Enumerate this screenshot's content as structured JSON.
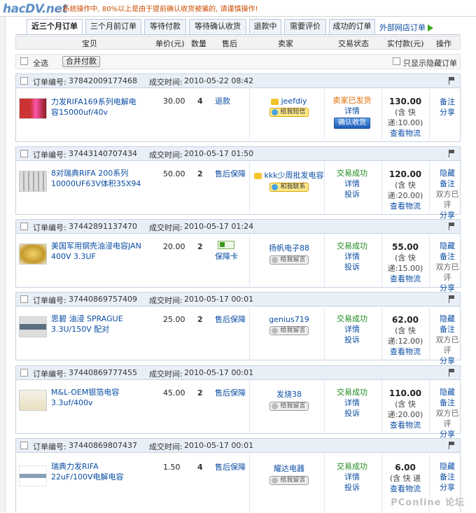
{
  "site": {
    "logo": "hacDV.net",
    "notice": "...系统操作中, 80%以上是由于提前确认收货被骗的, 请谨慎操作!"
  },
  "tabs": [
    {
      "label": "近三个月订单",
      "active": true
    },
    {
      "label": "三个月前订单",
      "active": false
    },
    {
      "label": "等待付款",
      "active": false
    },
    {
      "label": "等待确认收货",
      "active": false
    },
    {
      "label": "退款中",
      "active": false
    },
    {
      "label": "需要评价",
      "active": false
    },
    {
      "label": "成功的订单",
      "active": false
    }
  ],
  "external_link": "外部网店订单",
  "columns": {
    "item": "宝贝",
    "price": "单价(元)",
    "qty": "数量",
    "after_sale": "售后",
    "seller": "卖家",
    "status": "交易状态",
    "paid": "实付款(元)",
    "ops": "操作"
  },
  "toolbar": {
    "select_all": "全选",
    "merge_pay": "合并付款",
    "only_hidden": "只显示隐藏订单"
  },
  "orders": [
    {
      "order_label": "订单编号:",
      "order_no": "37842009177468",
      "time_label": "成交时间:",
      "time": "2010-05-22 08:42",
      "title": "力发RIFA169系列电解电容15000uf/40v",
      "price": "30.00",
      "qty": "4",
      "after_sale": "退款",
      "seller": "jeefdiy",
      "seller_button": "给我短信",
      "status_main": "卖家已发货",
      "status_detail": "详情",
      "status_extra": "",
      "confirm_button": "确认收货",
      "paid": "130.00",
      "paid_note": "(含 快 递:10.00)",
      "logistics": "查看物流",
      "ops": [
        "备注",
        "分享"
      ]
    },
    {
      "order_label": "订单编号:",
      "order_no": "37443140707434",
      "time_label": "成交时间:",
      "time": "2010-05-17 01:50",
      "title": "8对瑞典RIFA 200系列 10000UF63V体积35X94",
      "price": "50.00",
      "qty": "2",
      "after_sale": "售后保障",
      "seller": "kkk少周批发电容",
      "seller_button": "和我联系",
      "status_main": "交易成功",
      "status_detail": "详情",
      "status_extra": "投诉",
      "confirm_button": "",
      "paid": "120.00",
      "paid_note": "(含 快 递:20.00)",
      "logistics": "查看物流",
      "ops": [
        "隐藏",
        "备注",
        "双方已评",
        "分享"
      ]
    },
    {
      "order_label": "订单编号:",
      "order_no": "37442891137470",
      "time_label": "成交时间:",
      "time": "2010-05-17 01:24",
      "title": "美国军用钢壳油浸电容JAN 400V 3.3UF",
      "price": "20.00",
      "qty": "2",
      "after_sale": "保障卡",
      "seller": "扬帆电子88",
      "seller_button": "给我留言",
      "status_main": "交易成功",
      "status_detail": "详情",
      "status_extra": "投诉",
      "confirm_button": "",
      "paid": "55.00",
      "paid_note": "(含 快 递:15.00)",
      "logistics": "查看物流",
      "ops": [
        "隐藏",
        "备注",
        "双方已评",
        "分享"
      ]
    },
    {
      "order_label": "订单编号:",
      "order_no": "37440869757409",
      "time_label": "成交时间:",
      "time": "2010-05-17 00:01",
      "title": "思碧 油浸 SPRAGUE 3.3U/150V 配对",
      "price": "25.00",
      "qty": "2",
      "after_sale": "售后保障",
      "seller": "genius719",
      "seller_button": "给我留言",
      "status_main": "交易成功",
      "status_detail": "详情",
      "status_extra": "投诉",
      "confirm_button": "",
      "paid": "62.00",
      "paid_note": "(含 快 递:12.00)",
      "logistics": "查看物流",
      "ops": [
        "隐藏",
        "备注",
        "双方已评",
        "分享"
      ]
    },
    {
      "order_label": "订单编号:",
      "order_no": "37440869777455",
      "time_label": "成交时间:",
      "time": "2010-05-17 00:01",
      "title": "M&L-OEM银箔电容 3.3uf/400v",
      "price": "45.00",
      "qty": "2",
      "after_sale": "售后保障",
      "seller": "发烧38",
      "seller_button": "给我留言",
      "status_main": "交易成功",
      "status_detail": "详情",
      "status_extra": "投诉",
      "confirm_button": "",
      "paid": "110.00",
      "paid_note": "(含 快 递:20.00)",
      "logistics": "查看物流",
      "ops": [
        "隐藏",
        "备注",
        "双方已评",
        "分享"
      ]
    },
    {
      "order_label": "订单编号:",
      "order_no": "37440869807437",
      "time_label": "成交时间:",
      "time": "2010-05-17 00:01",
      "title": "瑞典力发RIFA 22uF/100V电解电容",
      "price": "1.50",
      "qty": "4",
      "after_sale": "售后保障",
      "seller": "耀达电器",
      "seller_button": "给我留言",
      "status_main": "交易成功",
      "status_detail": "详情",
      "status_extra": "投诉",
      "confirm_button": "",
      "paid": "6.00",
      "paid_note": "(含 快 递",
      "logistics": "查看物流",
      "ops": [
        "隐藏",
        "备注",
        "分享"
      ]
    }
  ],
  "watermark": "PConline 论坛",
  "colors": {
    "link": "#0a4da3",
    "success": "#1d8a1d",
    "shipped": "#e06b00",
    "tab_border": "#b9c9dc"
  }
}
